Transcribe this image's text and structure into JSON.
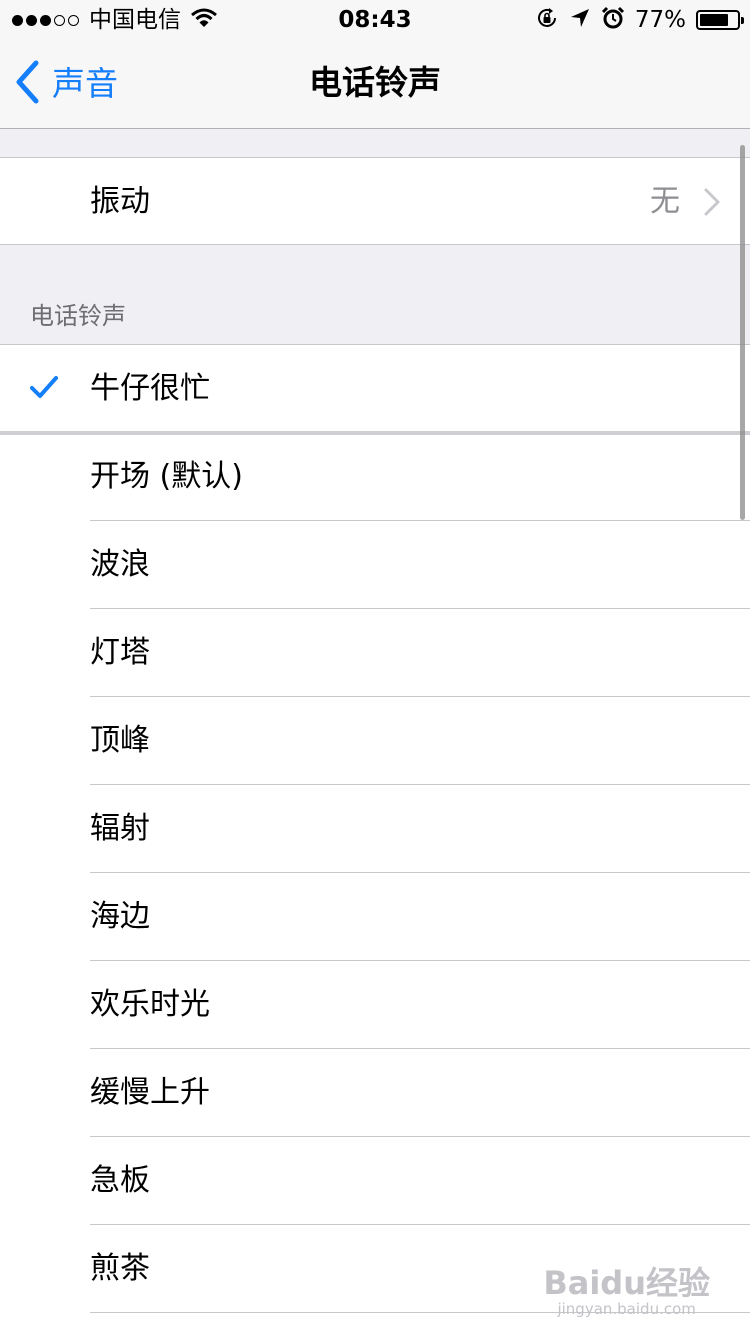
{
  "status_bar": {
    "signal_dots": [
      true,
      true,
      true,
      false,
      false
    ],
    "carrier": "中国电信",
    "time": "08:43",
    "battery_percent": "77%",
    "battery_level": 0.77,
    "icons": [
      "wifi-icon",
      "rotation-lock-icon",
      "location-arrow-icon",
      "alarm-icon",
      "battery-icon"
    ]
  },
  "nav": {
    "back_label": "声音",
    "title": "电话铃声"
  },
  "vibration": {
    "label": "振动",
    "value": "无"
  },
  "ringtones": {
    "section_header": "电话铃声",
    "items": [
      {
        "label": "牛仔很忙",
        "selected": true
      },
      {
        "label": "开场 (默认)",
        "selected": false
      },
      {
        "label": "波浪",
        "selected": false
      },
      {
        "label": "灯塔",
        "selected": false
      },
      {
        "label": "顶峰",
        "selected": false
      },
      {
        "label": "辐射",
        "selected": false
      },
      {
        "label": "海边",
        "selected": false
      },
      {
        "label": "欢乐时光",
        "selected": false
      },
      {
        "label": "缓慢上升",
        "selected": false
      },
      {
        "label": "急板",
        "selected": false
      },
      {
        "label": "煎茶",
        "selected": false
      }
    ]
  },
  "colors": {
    "accent": "#157efb",
    "background": "#efeff4",
    "separator": "#c8c7cc",
    "secondary_text": "#8e8e93"
  },
  "watermark": {
    "brand": "Baidu经验",
    "url": "jingyan.baidu.com"
  }
}
